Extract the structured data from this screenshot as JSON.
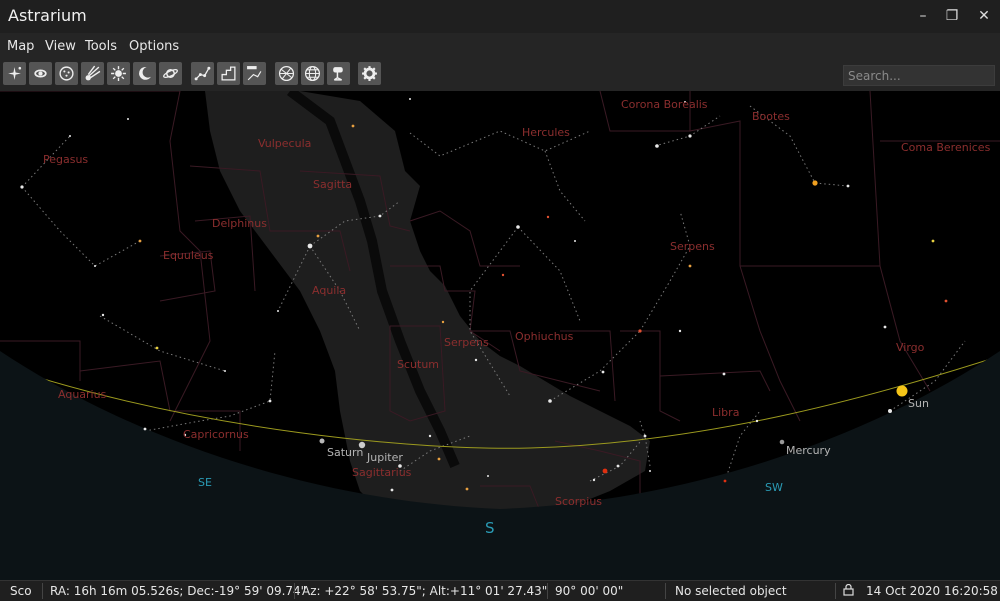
{
  "window": {
    "title": "Astrarium"
  },
  "window_controls": {
    "minimize": "–",
    "restore": "❐",
    "close": "✕"
  },
  "menu": [
    "Map",
    "View",
    "Tools",
    "Options"
  ],
  "toolbar": {
    "buttons": [
      "stars-icon",
      "galaxy-icon",
      "star-cluster-icon",
      "comet-icon",
      "sun-icon",
      "moon-icon",
      "planet-icon",
      "constellation-lines-icon",
      "constellation-borders-icon",
      "constellation-labels-icon",
      "equatorial-grid-icon",
      "horizontal-grid-icon",
      "telescope-icon",
      "settings-icon"
    ]
  },
  "search": {
    "placeholder": "Search..."
  },
  "sky_labels": {
    "constellations": [
      "Pegasus",
      "Vulpecula",
      "Sagitta",
      "Hercules",
      "Corona Borealis",
      "Bootes",
      "Coma Berenices",
      "Delphinus",
      "Equuleus",
      "Serpens",
      "Aquila",
      "Ophiuchus",
      "Serpens",
      "Scutum",
      "Virgo",
      "Aquarius",
      "Libra",
      "Capricornus",
      "Sagittarius",
      "Scorpius"
    ],
    "planets": [
      "Saturn",
      "Jupiter",
      "Mercury",
      "Sun"
    ],
    "directions": [
      "SE",
      "S",
      "SW"
    ]
  },
  "status": {
    "constellation": "Sco",
    "ra_dec": "RA: 16h 16m 05.526s; Dec:-19° 59' 09.74\"",
    "az_alt": "Az: +22° 58' 53.75\"; Alt:+11° 01' 27.43\"",
    "fov": "90° 00' 00\"",
    "selection": "No selected object",
    "datetime": "14 Oct 2020 16:20:58"
  },
  "colors": {
    "constellation_label": "#8b2e2e",
    "ecliptic": "#9c9a1e",
    "horizon_label": "#2a9bb5",
    "ground": "#0c1316",
    "milky_way": "#1e1e1e"
  }
}
